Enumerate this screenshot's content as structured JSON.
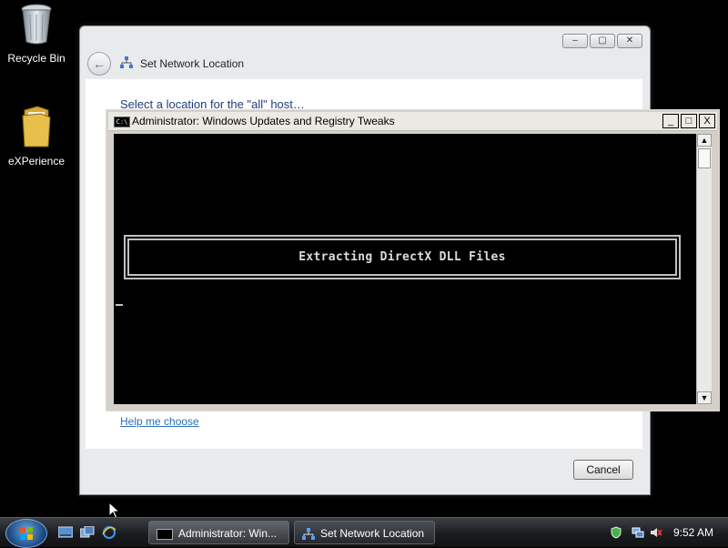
{
  "desktop": {
    "icons": [
      {
        "label": "Recycle Bin",
        "icon": "recycle-bin-icon"
      },
      {
        "label": "eXPerience",
        "icon": "folder-icon"
      }
    ]
  },
  "network_window": {
    "title": "Set Network Location",
    "heading": "Select a location for the \"all\" host…",
    "help_link": "Help me choose",
    "cancel_label": "Cancel",
    "caption_buttons": {
      "minimize": "–",
      "maximize": "▢",
      "close": "✕"
    }
  },
  "cmd_window": {
    "title": "Administrator:  Windows Updates and Registry Tweaks",
    "icon_text": "C:\\",
    "caption_buttons": {
      "minimize": "_",
      "maximize": "□",
      "close": "X"
    },
    "console_message": "Extracting DirectX DLL Files",
    "scroll": {
      "up": "▲",
      "down": "▼"
    }
  },
  "taskbar": {
    "buttons": [
      {
        "label": "Administrator:  Win...",
        "icon": "console-icon"
      },
      {
        "label": "Set Network Location",
        "icon": "network-icon"
      }
    ],
    "clock": "9:52 AM"
  },
  "colors": {
    "desktop": "#000000",
    "window_frame": "#e9eaec",
    "console_bg": "#000000",
    "console_text": "#dcdcdc",
    "link": "#2a6fb8"
  }
}
